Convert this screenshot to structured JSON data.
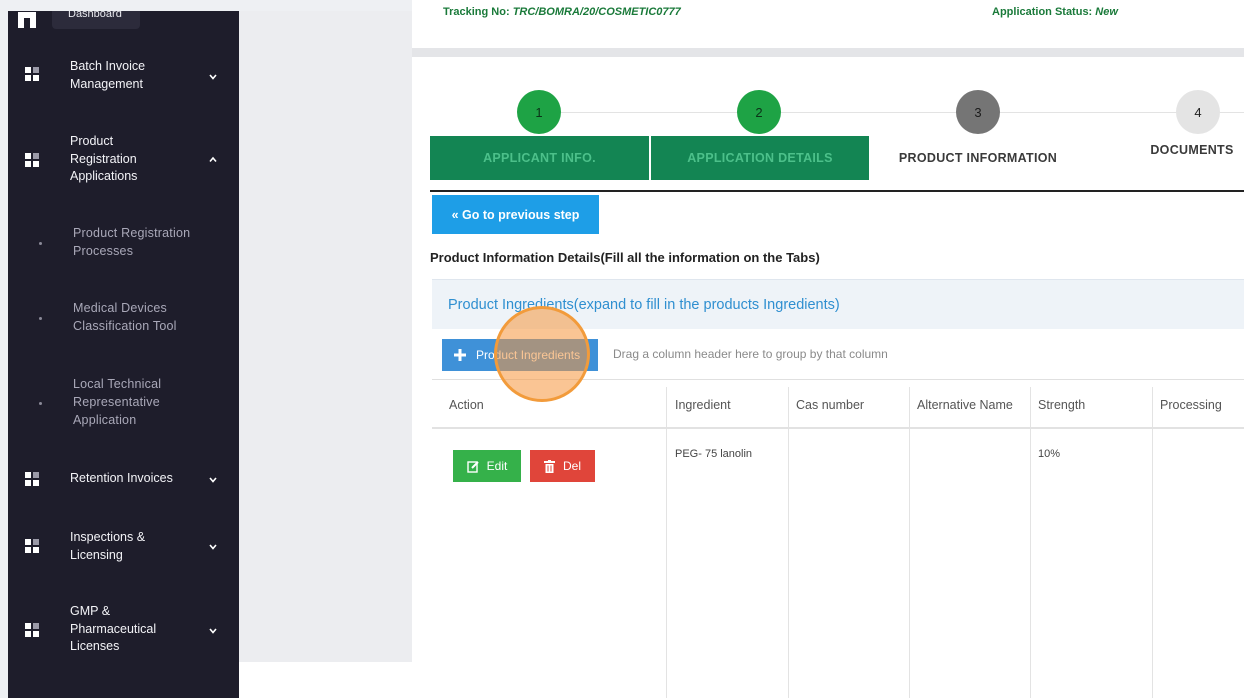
{
  "sidebar": {
    "dashboard_label": "Dashboard",
    "items": [
      {
        "label": "Batch Invoice Management",
        "expanded": false
      },
      {
        "label": "Product Registration Applications",
        "expanded": true
      },
      {
        "label": "Retention Invoices",
        "expanded": false
      },
      {
        "label": "Inspections & Licensing",
        "expanded": false
      },
      {
        "label": "GMP & Pharmaceutical Licenses",
        "expanded": false
      }
    ],
    "subitems": [
      {
        "label": "Product Registration Processes"
      },
      {
        "label": "Medical Devices Classification Tool"
      },
      {
        "label": "Local Technical Representative Application"
      }
    ]
  },
  "header": {
    "tracking_label": "Tracking No: ",
    "tracking_value": "TRC/BOMRA/20/COSMETIC0777",
    "status_label": "Application Status: ",
    "status_value": "New"
  },
  "wizard": {
    "steps": [
      {
        "number": "1",
        "label": "APPLICANT INFO.",
        "state": "done"
      },
      {
        "number": "2",
        "label": "APPLICATION DETAILS",
        "state": "done"
      },
      {
        "number": "3",
        "label": "PRODUCT INFORMATION",
        "state": "current"
      },
      {
        "number": "4",
        "label": "DOCUMENTS",
        "state": "pending"
      }
    ],
    "prev_button": "« Go to previous step"
  },
  "main": {
    "section_title": "Product Information Details(Fill all the information on the Tabs)",
    "panel_title": "Product Ingredients(expand to fill in the products Ingredients)",
    "add_button": "Product Ingredients",
    "group_hint": "Drag a column header here to group by that column",
    "columns": [
      "Action",
      "Ingredient",
      "Cas number",
      "Alternative Name",
      "Strength",
      "Processing"
    ],
    "rows": [
      {
        "ingredient": "PEG- 75 lanolin",
        "cas_number": "",
        "alternative_name": "",
        "strength": "10%",
        "processing": ""
      }
    ],
    "edit_label": "Edit",
    "delete_label": "Del"
  },
  "colors": {
    "sidebar_bg": "#1e1d2b",
    "step_done": "#1ea345",
    "tab_done": "#138553",
    "primary_blue": "#1e9ee7",
    "edit_green": "#35b14a",
    "delete_red": "#e0453a",
    "click_highlight": "#f29b3b"
  }
}
